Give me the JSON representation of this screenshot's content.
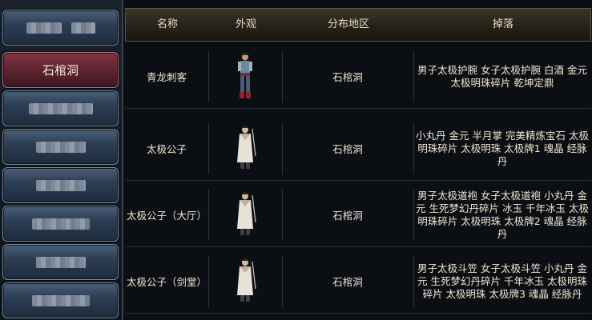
{
  "sidebar": {
    "items": [
      {
        "label": "",
        "blurred": true
      },
      {
        "label": "石棺洞",
        "active": true
      },
      {
        "label": "",
        "blurred": true
      },
      {
        "label": "",
        "blurred": true
      },
      {
        "label": "",
        "blurred": true
      },
      {
        "label": "",
        "blurred": true
      },
      {
        "label": "",
        "blurred": true
      },
      {
        "label": "",
        "blurred": true
      }
    ]
  },
  "table": {
    "headers": {
      "name": "名称",
      "appearance": "外观",
      "region": "分布地区",
      "drops": "掉落"
    },
    "rows": [
      {
        "name": "青龙刺客",
        "appearance_icon": "assassin-sprite-icon",
        "region": "石棺洞",
        "drops": "男子太极护腕 女子太极护腕 白酒 金元 太极明珠碎片 乾坤定鼎"
      },
      {
        "name": "太极公子",
        "appearance_icon": "taiji-gongzi-sprite-icon",
        "region": "石棺洞",
        "drops": "小丸丹 金元 半月掌 完美精炼宝石 太极明珠碎片 太极明珠 太极牌1 魂晶 经脉丹"
      },
      {
        "name": "太极公子（大厅）",
        "appearance_icon": "taiji-gongzi-sprite-icon",
        "region": "石棺洞",
        "drops": "男子太极道袍 女子太极道袍 小丸丹 金元 生死梦幻丹碎片 冰玉 千年冰玉 太极明珠碎片 太极明珠 太极牌2 魂晶 经脉丹"
      },
      {
        "name": "太极公子（剑堂）",
        "appearance_icon": "taiji-gongzi-sprite-icon",
        "region": "石棺洞",
        "drops": "男子太极斗笠 女子太极斗笠 小丸丹 金元 生死梦幻丹碎片 千年冰玉 太极明珠碎片 太极明珠 太极牌3 魂晶 经脉丹"
      }
    ]
  },
  "colors": {
    "active_tab": "#5e2531",
    "tab": "#2e3f55",
    "header": "#242016",
    "text": "#f0e6d3"
  }
}
